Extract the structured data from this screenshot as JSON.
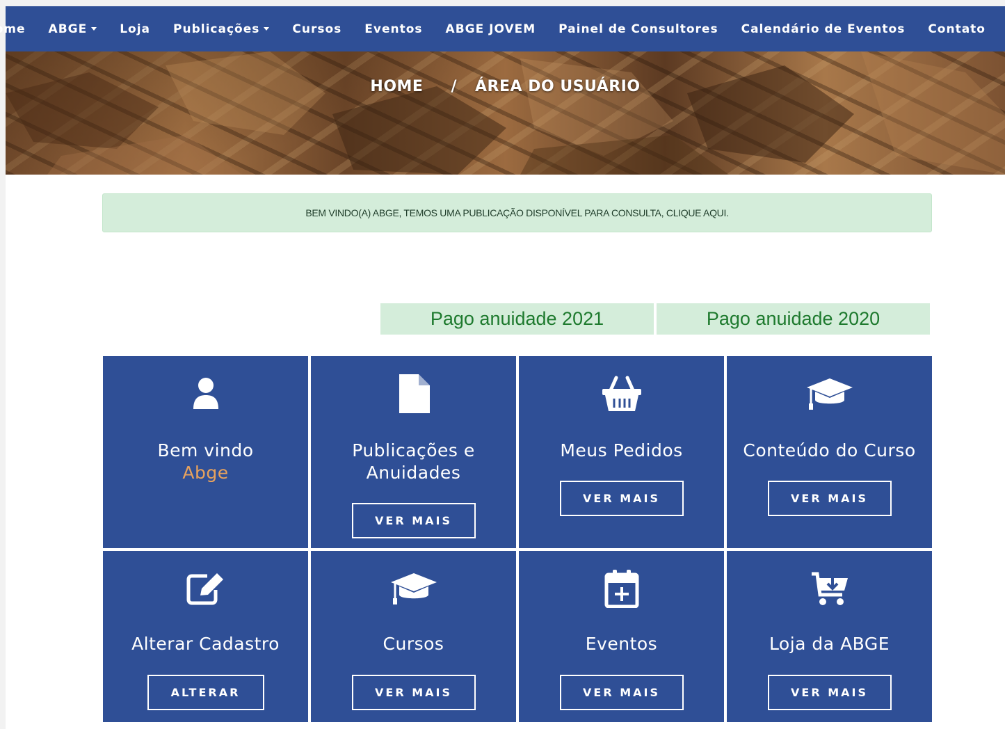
{
  "nav": {
    "items": [
      {
        "label": "Home",
        "dropdown": false
      },
      {
        "label": "ABGE",
        "dropdown": true
      },
      {
        "label": "Loja",
        "dropdown": false
      },
      {
        "label": "Publicações",
        "dropdown": true
      },
      {
        "label": "Cursos",
        "dropdown": false
      },
      {
        "label": "Eventos",
        "dropdown": false
      },
      {
        "label": "ABGE JOVEM",
        "dropdown": false
      },
      {
        "label": "Painel de Consultores",
        "dropdown": false
      },
      {
        "label": "Calendário de Eventos",
        "dropdown": false
      },
      {
        "label": "Contato",
        "dropdown": false
      }
    ]
  },
  "breadcrumb": {
    "home": "HOME",
    "separator": "/",
    "current": "ÁREA DO USUÁRIO"
  },
  "alert": {
    "text": "BEM VINDO(A) ABGE, TEMOS UMA PUBLICAÇÃO DISPONÍVEL PARA CONSULTA, CLIQUE AQUI."
  },
  "status": {
    "paid_2021": "Pago anuidade 2021",
    "paid_2020": "Pago anuidade 2020"
  },
  "tiles": {
    "welcome": {
      "title": "Bem vindo",
      "user": "Abge",
      "icon": "user-icon"
    },
    "publications": {
      "title_line1": "Publicações e",
      "title_line2": "Anuidades",
      "button": "VER MAIS",
      "icon": "document-icon"
    },
    "orders": {
      "title": "Meus Pedidos",
      "button": "VER MAIS",
      "icon": "shopping-basket-icon"
    },
    "course_content": {
      "title": "Conteúdo do Curso",
      "button": "VER MAIS",
      "icon": "graduation-cap-icon"
    },
    "edit_profile": {
      "title": "Alterar Cadastro",
      "button": "ALTERAR",
      "icon": "edit-icon"
    },
    "courses": {
      "title": "Cursos",
      "button": "VER MAIS",
      "icon": "graduation-cap-icon"
    },
    "events": {
      "title": "Eventos",
      "button": "VER MAIS",
      "icon": "calendar-plus-icon"
    },
    "store": {
      "title": "Loja da ABGE",
      "button": "VER MAIS",
      "icon": "cart-download-icon"
    }
  },
  "colors": {
    "primary": "#2f4f96",
    "alert_bg": "#d4edda",
    "status_text": "#1e7a2e",
    "accent": "#e7a25d"
  }
}
